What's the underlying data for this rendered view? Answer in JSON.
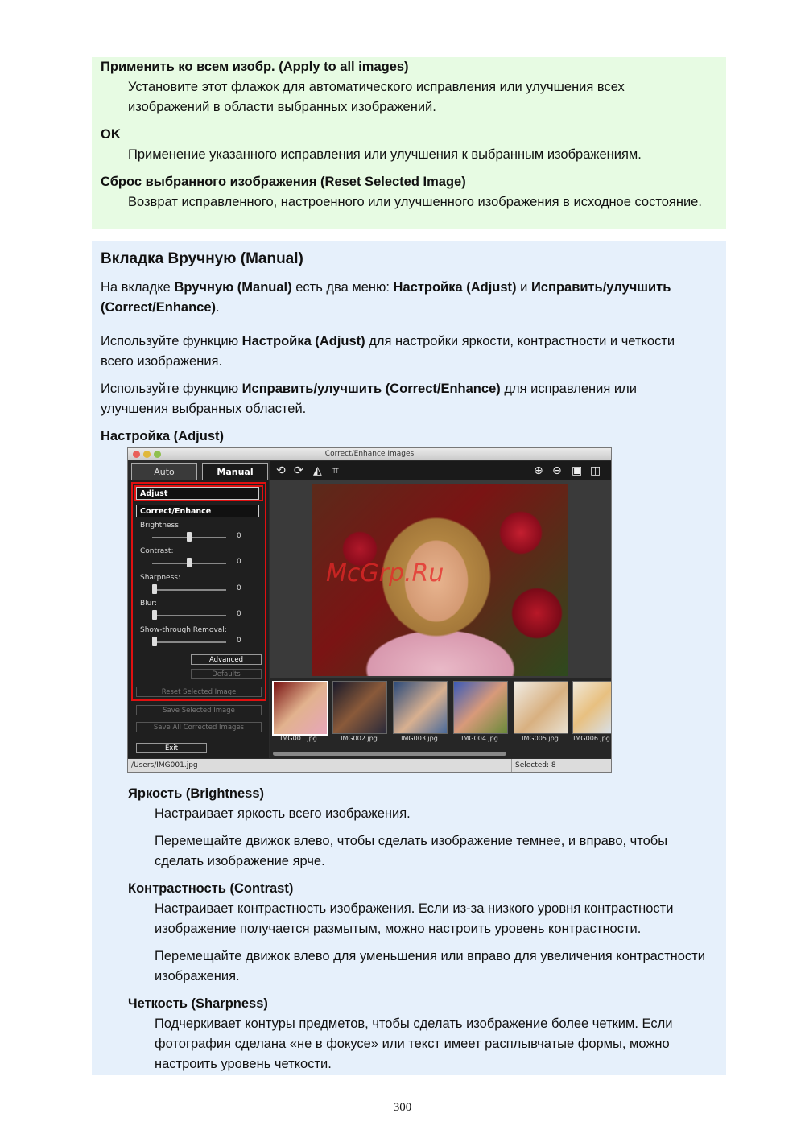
{
  "green_section": {
    "item1_title": "Применить ко всем изобр. (Apply to all images)",
    "item1_line1": "Установите этот флажок для автоматического исправления или улучшения всех",
    "item1_line2": "изображений в области выбранных изображений.",
    "item2_title": "OK",
    "item2_line1": "Применение указанного исправления или улучшения к выбранным изображениям.",
    "item3_title": "Сброс выбранного изображения (Reset Selected Image)",
    "item3_line1": "Возврат исправленного, настроенного или улучшенного изображения в исходное состояние."
  },
  "blue_section": {
    "heading": "Вкладка Вручную (Manual)",
    "p1_a": "На вкладке ",
    "p1_b": "Вручную (Manual)",
    "p1_c": " есть два меню: ",
    "p1_d": "Настройка (Adjust)",
    "p1_e": " и ",
    "p1_f": "Исправить/улучшить",
    "p1_g": "(Correct/Enhance)",
    "p1_h": ".",
    "p2_a": "Используйте функцию ",
    "p2_b": "Настройка (Adjust)",
    "p2_c": " для настройки яркости, контрастности и четкости",
    "p2_line2": "всего изображения.",
    "p3_a": "Используйте функцию ",
    "p3_b": "Исправить/улучшить (Correct/Enhance)",
    "p3_c": " для исправления или",
    "p3_line2": "улучшения выбранных областей.",
    "subheading": "Настройка (Adjust)",
    "brightness_title": "Яркость (Brightness)",
    "brightness_l1": "Настраивает яркость всего изображения.",
    "brightness_l2": "Перемещайте движок влево, чтобы сделать изображение темнее, и вправо, чтобы",
    "brightness_l3": "сделать изображение ярче.",
    "contrast_title": "Контрастность (Contrast)",
    "contrast_l1": "Настраивает контрастность изображения. Если из-за низкого уровня контрастности",
    "contrast_l2": "изображение получается размытым, можно настроить уровень контрастности.",
    "contrast_l3": "Перемещайте движок влево для уменьшения или вправо для увеличения контрастности",
    "contrast_l4": "изображения.",
    "sharpness_title": "Четкость (Sharpness)",
    "sharpness_l1": "Подчеркивает контуры предметов, чтобы сделать изображение более четким. Если",
    "sharpness_l2": "фотография сделана «не в фокусе» или текст имеет расплывчатые формы, можно",
    "sharpness_l3": "настроить уровень четкости."
  },
  "app": {
    "window_title": "Correct/Enhance Images",
    "tab_auto": "Auto",
    "tab_manual": "Manual",
    "menu_adjust": "Adjust",
    "menu_correct": "Correct/Enhance",
    "sliders": [
      {
        "label": "Brightness:",
        "value": "0",
        "level": 0.5
      },
      {
        "label": "Contrast:",
        "value": "0",
        "level": 0.5
      },
      {
        "label": "Sharpness:",
        "value": "0",
        "level": 0.0
      },
      {
        "label": "Blur:",
        "value": "0",
        "level": 0.0
      },
      {
        "label": "Show-through Removal:",
        "value": "0",
        "level": 0.0
      }
    ],
    "btn_advanced": "Advanced",
    "btn_defaults": "Defaults",
    "btn_reset": "Reset Selected Image",
    "btn_save_selected": "Save Selected Image",
    "btn_save_all": "Save All Corrected Images",
    "btn_exit": "Exit",
    "thumbnails": [
      "IMG001.jpg",
      "IMG002.jpg",
      "IMG003.jpg",
      "IMG004.jpg",
      "IMG005.jpg",
      "IMG006.jpg"
    ],
    "status_path": "/Users/IMG001.jpg",
    "status_selected": "Selected: 8",
    "watermark": "McGrp.Ru",
    "highlight_color": "#e01010"
  },
  "page_number": "300"
}
